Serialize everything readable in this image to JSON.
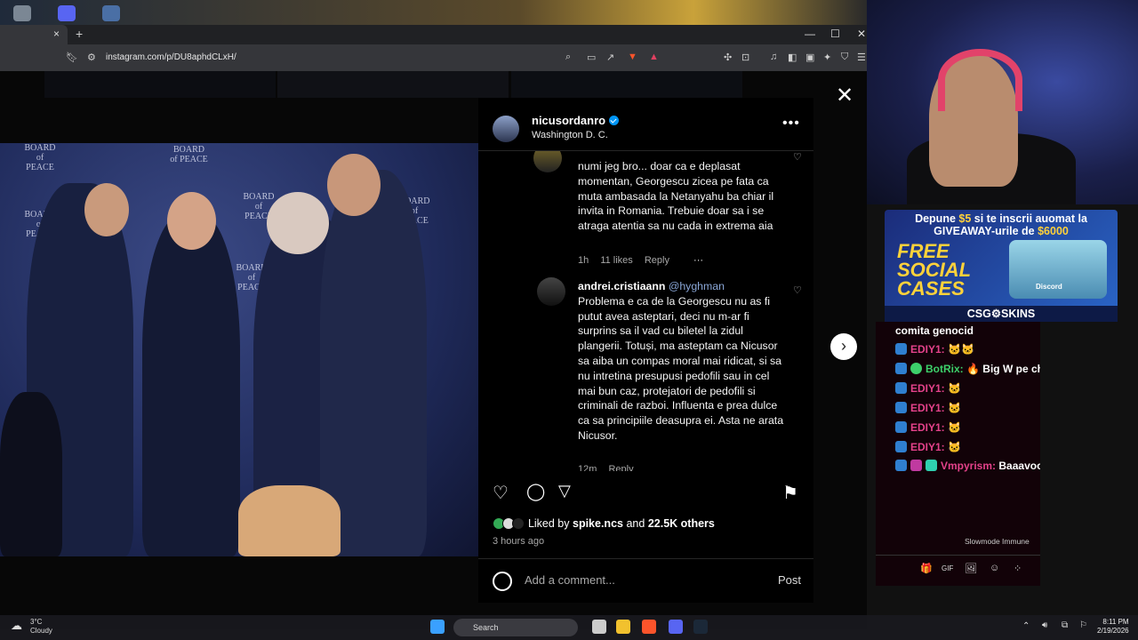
{
  "browser": {
    "tab_close": "×",
    "new_tab": "+",
    "minimize": "—",
    "maximize": "☐",
    "close": "✕",
    "url": "instagram.com/p/DU8aphdCLxH/"
  },
  "post": {
    "username": "nicusordanro",
    "location": "Washington D. C.",
    "more": "•••",
    "close_icon": "✕",
    "next_icon": "›",
    "photo_board_texts": [
      "BOARD of PEACE",
      "BOARD of PEACE",
      "BOARD of PEACE",
      "BOARD of PEACE",
      "BOARD of PEACE",
      "BOARD of PEACE"
    ]
  },
  "comments": [
    {
      "text": "numi jeg bro... doar ca e deplasat momentan, Georgescu zicea pe fata ca muta ambasada la Netanyahu ba chiar il invita in Romania. Trebuie doar sa i se atraga atentia sa nu cada in extrema aia",
      "time": "1h",
      "likes": "11 likes",
      "reply": "Reply",
      "more": "···"
    },
    {
      "user": "andrei.cristiaann",
      "mention": "@hyghman",
      "text": "Problema e ca de la Georgescu nu as fi putut avea asteptari, deci nu m-ar fi surprins sa il vad cu biletel la zidul plangerii. Totuși, ma asteptam ca Nicusor sa aiba un compas moral mai ridicat, si sa nu intretina presupusi pedofili sau in cel mai bun caz, protejatori de pedofili si criminali de razboi. Influenta e prea dulce ca sa principiile deasupra ei. Asta ne arata Nicusor.",
      "time": "12m",
      "reply": "Reply"
    }
  ],
  "actions": {
    "like_icon": "♡",
    "comment_icon": "◯",
    "share_icon": "▽",
    "save_icon": "⚑"
  },
  "likes": {
    "prefix": "Liked by",
    "user": "spike.ncs",
    "and": "and",
    "count": "22.5K others"
  },
  "post_time": "3 hours ago",
  "add_comment": {
    "placeholder": "Add a comment...",
    "post": "Post"
  },
  "stream": {
    "ad_line1_a": "Depune",
    "ad_amount": "$5",
    "ad_line1_b": "si te inscrii auomat la",
    "ad_line2_a": "GIVEAWAY-urile de",
    "ad_prize": "$6000",
    "ad_free": "FREE",
    "ad_social": "SOCIAL",
    "ad_cases": "CASES",
    "ad_box_label": "Discord",
    "ad_brand": "CSG⚙SKINS",
    "chat": [
      {
        "nick": "",
        "text": "comita genocid"
      },
      {
        "nick": "EDIY1:",
        "text": "🐱🐱"
      },
      {
        "nick": "BotRix:",
        "text": "🔥 Big W pe chat 🔥"
      },
      {
        "nick": "EDIY1:",
        "text": "🐱"
      },
      {
        "nick": "EDIY1:",
        "text": "🐱"
      },
      {
        "nick": "EDIY1:",
        "text": "🐱"
      },
      {
        "nick": "EDIY1:",
        "text": "🐱"
      },
      {
        "nick": "Vmpyrism:",
        "text": "Baaavoo"
      }
    ],
    "slowmode": "Slowmode Immune",
    "chat_bar_icons": [
      "🎁",
      "GIF",
      "🖼",
      "☺",
      "⁘"
    ]
  },
  "taskbar": {
    "temp": "3°C",
    "weather": "Cloudy",
    "search": "Search",
    "time": "8:11 PM",
    "date": "2/19/2026"
  }
}
